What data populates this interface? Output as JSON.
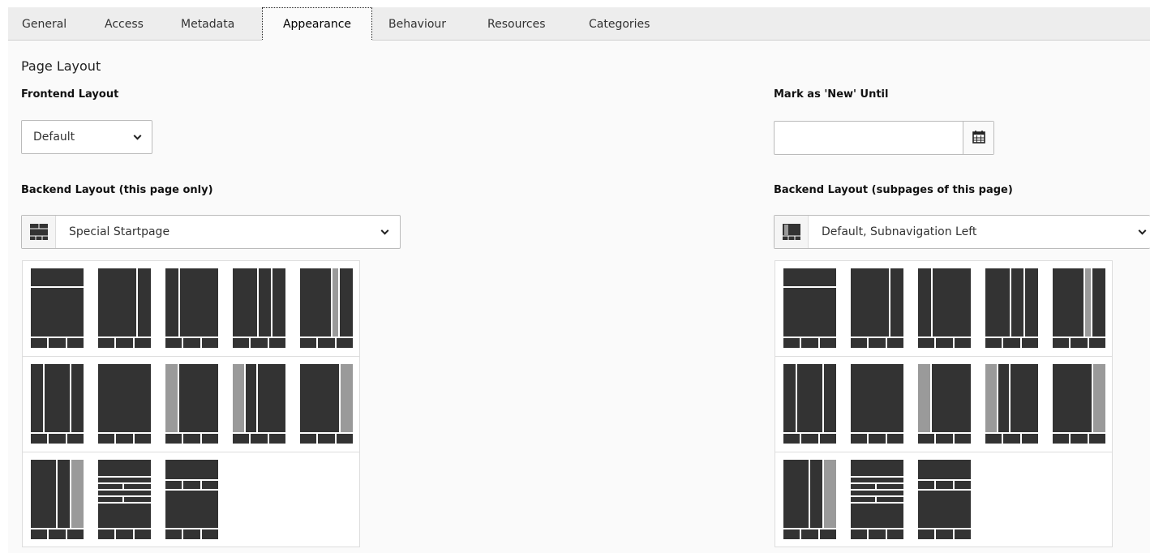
{
  "tabs": [
    {
      "label": "General"
    },
    {
      "label": "Access"
    },
    {
      "label": "Metadata"
    },
    {
      "label": "Appearance",
      "active": true
    },
    {
      "label": "Behaviour"
    },
    {
      "label": "Resources"
    },
    {
      "label": "Categories"
    }
  ],
  "section": {
    "title": "Page Layout"
  },
  "frontend_layout": {
    "label": "Frontend Layout",
    "value": "Default"
  },
  "mark_new": {
    "label": "Mark as 'New' Until",
    "value": ""
  },
  "backend_layout_page": {
    "label": "Backend Layout (this page only)",
    "value": "Special Startpage"
  },
  "backend_layout_sub": {
    "label": "Backend Layout (subpages of this page)",
    "value": "Default, Subnavigation Left"
  },
  "layout_options": [
    "header-main-footer",
    "main-right-footer",
    "left-main-footer",
    "left-main-right-footer",
    "main-grey-right-footer",
    "three-col-footer",
    "full-footer",
    "grey-left-main-footer",
    "grey-left-main-right-footer",
    "main-grey-right-wide-footer",
    "main-narrow-grey-right-footer",
    "striped-rows-footer",
    "header-split-main-footer"
  ],
  "colors": {
    "dark": "#333333",
    "grey": "#9a9a9a",
    "tabbar": "#ededed",
    "panel": "#fafafa"
  }
}
